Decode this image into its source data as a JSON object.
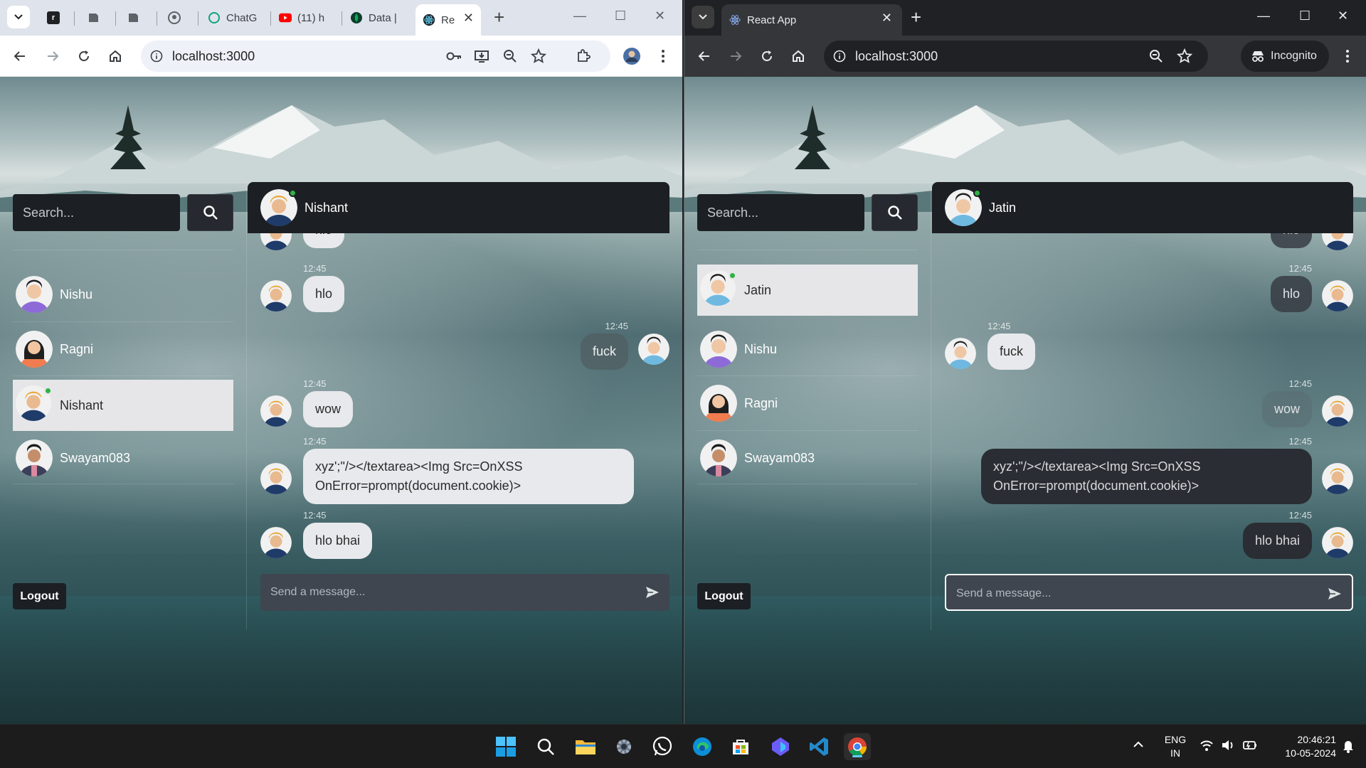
{
  "left_window": {
    "theme": "light",
    "tabs": [
      {
        "label": "",
        "favicon": "r-icon",
        "active": false
      },
      {
        "label": "",
        "favicon": "doc-icon",
        "active": false
      },
      {
        "label": "",
        "favicon": "doc-icon",
        "active": false
      },
      {
        "label": "",
        "favicon": "github-icon",
        "active": false
      },
      {
        "label": "ChatG",
        "favicon": "chatgpt-icon",
        "active": false
      },
      {
        "label": "(11) h",
        "favicon": "youtube-icon",
        "active": false
      },
      {
        "label": "Data |",
        "favicon": "mongodb-icon",
        "active": false
      },
      {
        "label": "Re",
        "favicon": "react-icon",
        "active": true
      }
    ],
    "url": "localhost:3000",
    "page": {
      "search_placeholder": "Search...",
      "contacts": [
        {
          "name": "Nishu",
          "avatar": "avatar-purple",
          "selected": false,
          "online": false
        },
        {
          "name": "Ragni",
          "avatar": "avatar-orange",
          "selected": false,
          "online": false
        },
        {
          "name": "Nishant",
          "avatar": "avatar-navy",
          "selected": true,
          "online": true
        },
        {
          "name": "Swayam083",
          "avatar": "avatar-pink",
          "selected": false,
          "online": false
        }
      ],
      "logout_label": "Logout",
      "chat_header": {
        "name": "Nishant",
        "online": true
      },
      "messages": [
        {
          "time": "",
          "text": "hlo",
          "side": "left",
          "partial": true
        },
        {
          "time": "12:45",
          "text": "hlo",
          "side": "left"
        },
        {
          "time": "12:45",
          "text": "fuck",
          "side": "right"
        },
        {
          "time": "12:45",
          "text": "wow",
          "side": "left"
        },
        {
          "time": "12:45",
          "text_line1": "xyz';\"/></textarea><Img Src=OnXSS",
          "text_line2": "OnError=prompt(document.cookie)>",
          "side": "left"
        },
        {
          "time": "12:45",
          "text": "hlo bhai",
          "side": "left"
        }
      ],
      "composer_placeholder": "Send a message..."
    }
  },
  "right_window": {
    "theme": "dark",
    "tabs": [
      {
        "label": "React App",
        "favicon": "react-icon",
        "active": true
      }
    ],
    "url": "localhost:3000",
    "incognito_label": "Incognito",
    "page": {
      "search_placeholder": "Search...",
      "contacts": [
        {
          "name": "Jatin",
          "avatar": "avatar-blue",
          "selected": true,
          "online": true
        },
        {
          "name": "Nishu",
          "avatar": "avatar-purple",
          "selected": false,
          "online": false
        },
        {
          "name": "Ragni",
          "avatar": "avatar-orange",
          "selected": false,
          "online": false
        },
        {
          "name": "Swayam083",
          "avatar": "avatar-pink",
          "selected": false,
          "online": false
        }
      ],
      "logout_label": "Logout",
      "chat_header": {
        "name": "Jatin",
        "online": true
      },
      "messages": [
        {
          "time": "",
          "text": "hlo",
          "side": "right",
          "partial": true
        },
        {
          "time": "12:45",
          "text": "hlo",
          "side": "right"
        },
        {
          "time": "12:45",
          "text": "fuck",
          "side": "left"
        },
        {
          "time": "12:45",
          "text": "wow",
          "side": "right"
        },
        {
          "time": "12:45",
          "text_line1": "xyz';\"/></textarea><Img Src=OnXSS",
          "text_line2": "OnError=prompt(document.cookie)>",
          "side": "right"
        },
        {
          "time": "12:45",
          "text": "hlo bhai",
          "side": "right"
        }
      ],
      "composer_placeholder": "Send a message..."
    }
  },
  "taskbar": {
    "apps": [
      "windows-start-icon",
      "search-icon",
      "file-explorer-icon",
      "settings-icon",
      "whatsapp-icon",
      "edge-icon",
      "store-icon",
      "copilot-icon",
      "vscode-icon",
      "chrome-icon"
    ],
    "language_line1": "ENG",
    "language_line2": "IN",
    "time": "20:46:21",
    "date": "10-05-2024"
  },
  "colors": {
    "online": "#2fb344",
    "chat_header_bg": "#1c1f24",
    "selected_contact_bg": "#e6e6e9",
    "composer_bg": "#3f4650"
  }
}
